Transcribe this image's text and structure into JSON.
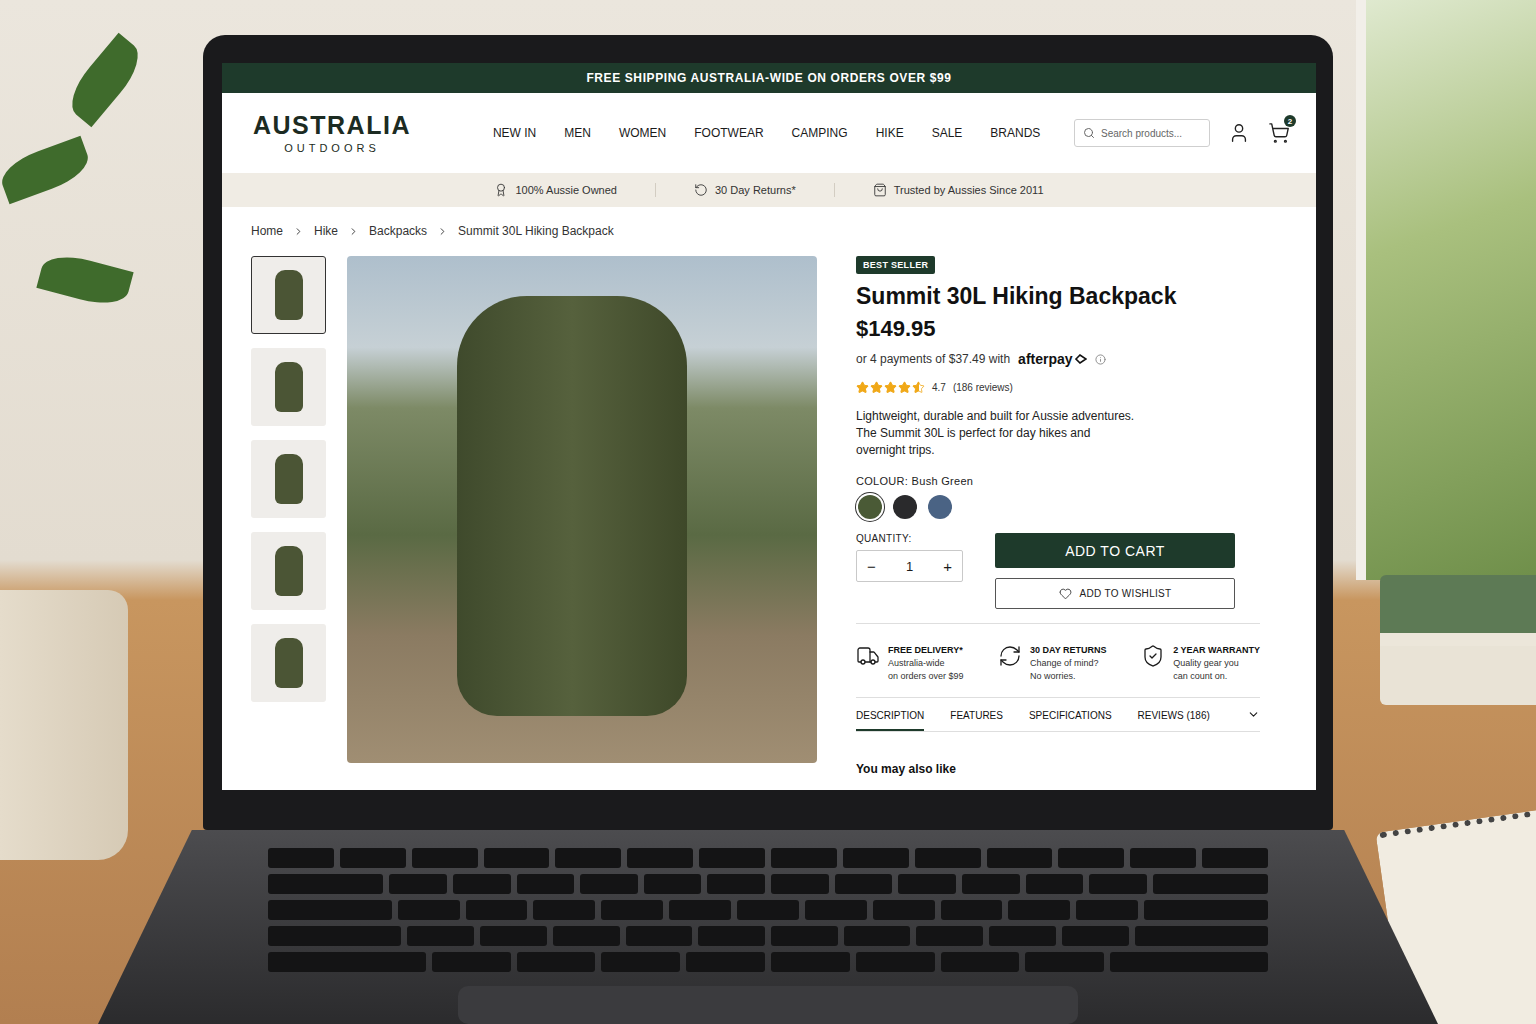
{
  "banner": {
    "text": "FREE SHIPPING AUSTRALIA-WIDE ON ORDERS OVER $99"
  },
  "logo": {
    "name": "AUSTRALIA",
    "sub": "OUTDOORS"
  },
  "nav": [
    "NEW IN",
    "MEN",
    "WOMEN",
    "FOOTWEAR",
    "CAMPING",
    "HIKE",
    "SALE",
    "BRANDS"
  ],
  "search": {
    "placeholder": "Search products..."
  },
  "cart": {
    "count": "2"
  },
  "trust": [
    {
      "label": "100% Aussie Owned"
    },
    {
      "label": "30 Day Returns*"
    },
    {
      "label": "Trusted by Aussies Since 2011"
    }
  ],
  "breadcrumb": [
    "Home",
    "Hike",
    "Backpacks",
    "Summit 30L Hiking Backpack"
  ],
  "gallery": {
    "thumbnails": [
      {
        "selected": true
      },
      {
        "selected": false
      },
      {
        "selected": false
      },
      {
        "selected": false
      },
      {
        "selected": false
      }
    ]
  },
  "product": {
    "badge": "BEST SELLER",
    "title": "Summit 30L Hiking Backpack",
    "price": "$149.95",
    "installments": "or 4 payments of $37.49 with",
    "afterpay": "afterpay",
    "rating": {
      "stars": 4.5,
      "value": "4.7",
      "count": "(186 reviews)"
    },
    "description": [
      "Lightweight, durable and built for Aussie adventures.",
      "The Summit 30L is perfect for day hikes and",
      "overnight trips."
    ],
    "colour": {
      "label": "COLOUR:",
      "value": "Bush Green",
      "swatches": [
        {
          "color": "#4a5a36",
          "selected": true
        },
        {
          "color": "#2a2a2c",
          "selected": false
        },
        {
          "color": "#4a6384",
          "selected": false
        }
      ]
    },
    "quantity": {
      "label": "QUANTITY:",
      "decrement": "−",
      "value": "1",
      "increment": "+"
    },
    "buttons": {
      "cart": "ADD TO CART",
      "wishlist": "ADD TO WISHLIST"
    }
  },
  "perks": [
    {
      "title": "FREE DELIVERY*",
      "lines": [
        "Australia-wide",
        "on orders over $99"
      ]
    },
    {
      "title": "30 DAY RETURNS",
      "lines": [
        "Change of mind?",
        "No worries."
      ]
    },
    {
      "title": "2 YEAR WARRANTY",
      "lines": [
        "Quality gear you",
        "can count on."
      ]
    }
  ],
  "tabs": [
    {
      "label": "DESCRIPTION",
      "selected": true
    },
    {
      "label": "FEATURES",
      "selected": false
    },
    {
      "label": "SPECIFICATIONS",
      "selected": false
    },
    {
      "label": "REVIEWS (186)",
      "selected": false
    }
  ],
  "related": {
    "title": "You may also like"
  }
}
